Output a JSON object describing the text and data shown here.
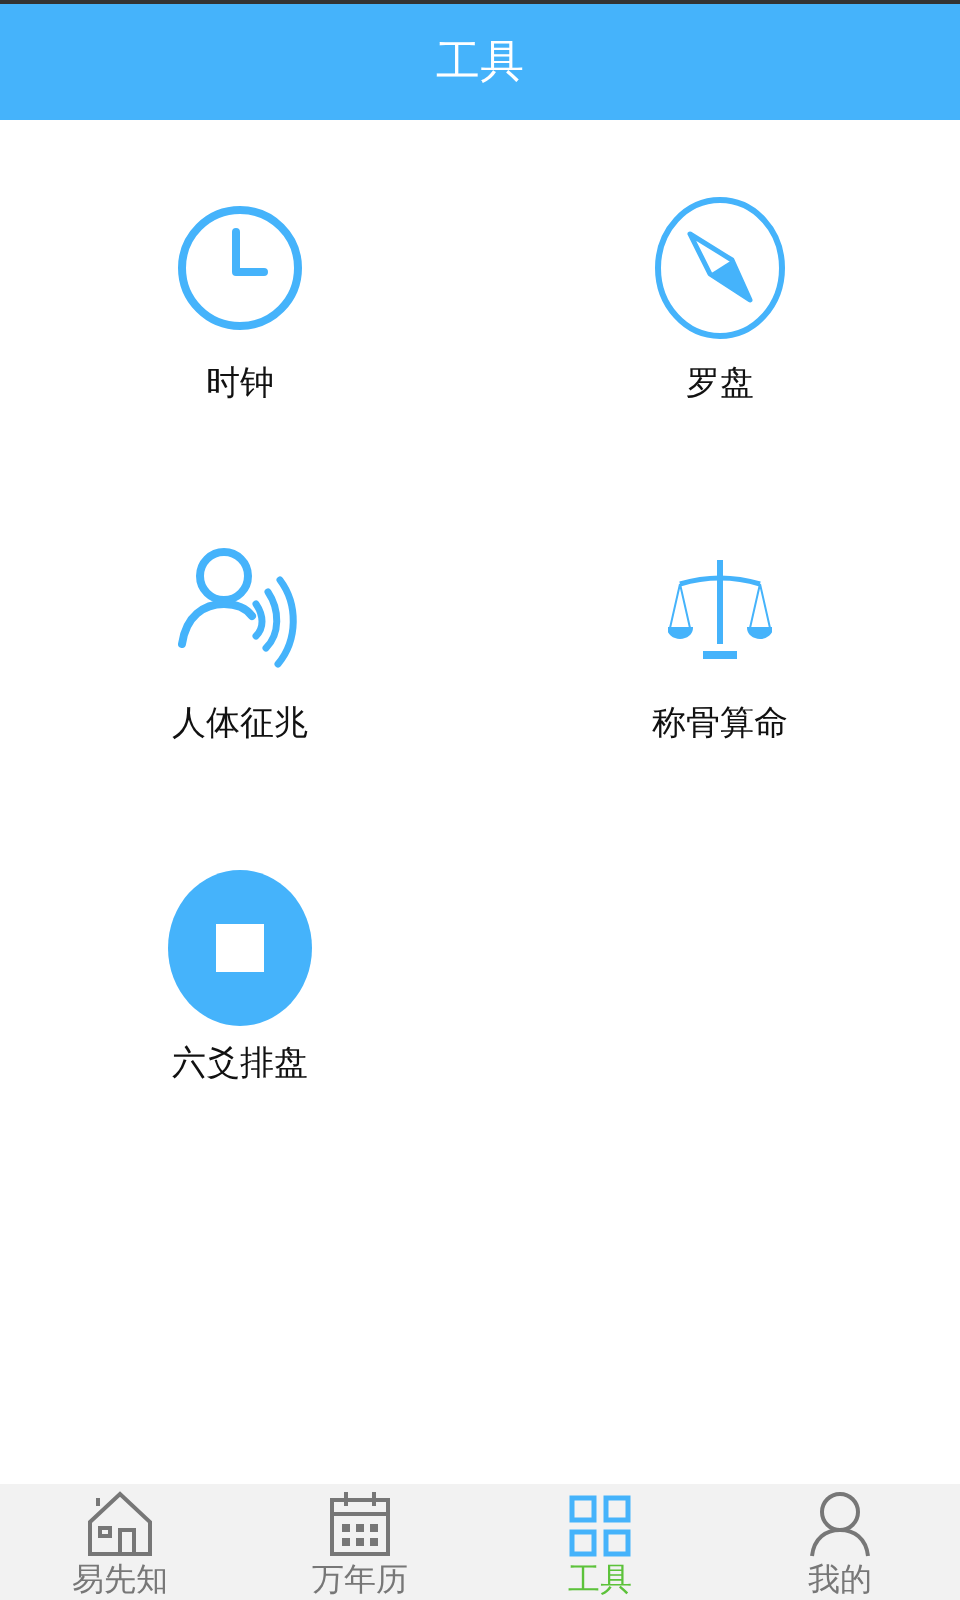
{
  "header": {
    "title": "工具"
  },
  "tools": [
    {
      "label": "时钟",
      "kind": "clock"
    },
    {
      "label": "罗盘",
      "kind": "compass"
    },
    {
      "label": "人体征兆",
      "kind": "person"
    },
    {
      "label": "称骨算命",
      "kind": "scale"
    },
    {
      "label": "六爻排盘",
      "kind": "square"
    }
  ],
  "tabs": [
    {
      "label": "易先知",
      "kind": "home",
      "selected": false
    },
    {
      "label": "万年历",
      "kind": "calendar",
      "selected": false
    },
    {
      "label": "工具",
      "kind": "grid",
      "selected": true
    },
    {
      "label": "我的",
      "kind": "user",
      "selected": false
    }
  ]
}
